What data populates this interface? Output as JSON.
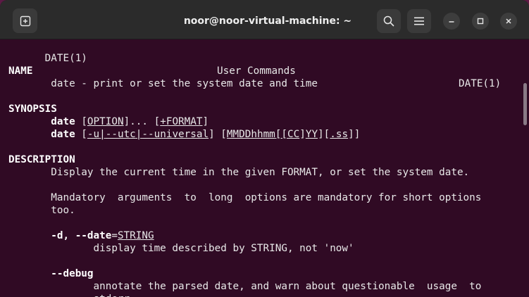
{
  "window": {
    "title": "noor@noor-virtual-machine: ~",
    "buttons": {
      "new_tab_icon": "new-tab-icon",
      "search_icon": "search-icon",
      "menu_icon": "hamburger-menu-icon",
      "minimize_icon": "minimize-icon",
      "maximize_icon": "maximize-icon",
      "close_icon": "close-icon"
    }
  },
  "colors": {
    "terminal_bg": "#300a24",
    "titlebar_bg": "#2b2b2b",
    "text": "#e8e8e8"
  },
  "man": {
    "header": {
      "left": "DATE(1)",
      "center": "User Commands",
      "right": "DATE(1)"
    },
    "name_heading": "NAME",
    "name_text": "       date - print or set the system date and time",
    "synopsis_heading": "SYNOPSIS",
    "synopsis_1": {
      "indent": "       ",
      "cmd": "date",
      "sp1": " ",
      "b1": "[",
      "opt": "OPTION",
      "b2": "]... [",
      "fmt": "+FORMAT",
      "b3": "]"
    },
    "synopsis_2": {
      "indent": "       ",
      "cmd": "date",
      "sp1": " [",
      "u1": "-u",
      "p1": "|",
      "u2": "--utc",
      "p2": "|",
      "u3": "--universal",
      "p3": "] [",
      "u4": "MMDDhhmm",
      "p4": "[[",
      "u5": "CC",
      "p5": "]",
      "u6": "YY",
      "p6": "][",
      "u7": ".ss",
      "p7": "]]"
    },
    "description_heading": "DESCRIPTION",
    "desc_1": "       Display the current time in the given FORMAT, or set the system date.",
    "desc_2": "       Mandatory  arguments  to  long  options are mandatory for short options",
    "desc_3": "       too.",
    "opt_date": {
      "indent": "       ",
      "flags": "-d, --date",
      "eq": "=",
      "arg": "STRING"
    },
    "opt_date_desc": "              display time described by STRING, not 'now'",
    "opt_debug": {
      "indent": "       ",
      "flags": "--debug"
    },
    "opt_debug_desc": "              annotate the parsed date, and warn about questionable  usage  to",
    "opt_debug_desc_2": "              stderr"
  }
}
